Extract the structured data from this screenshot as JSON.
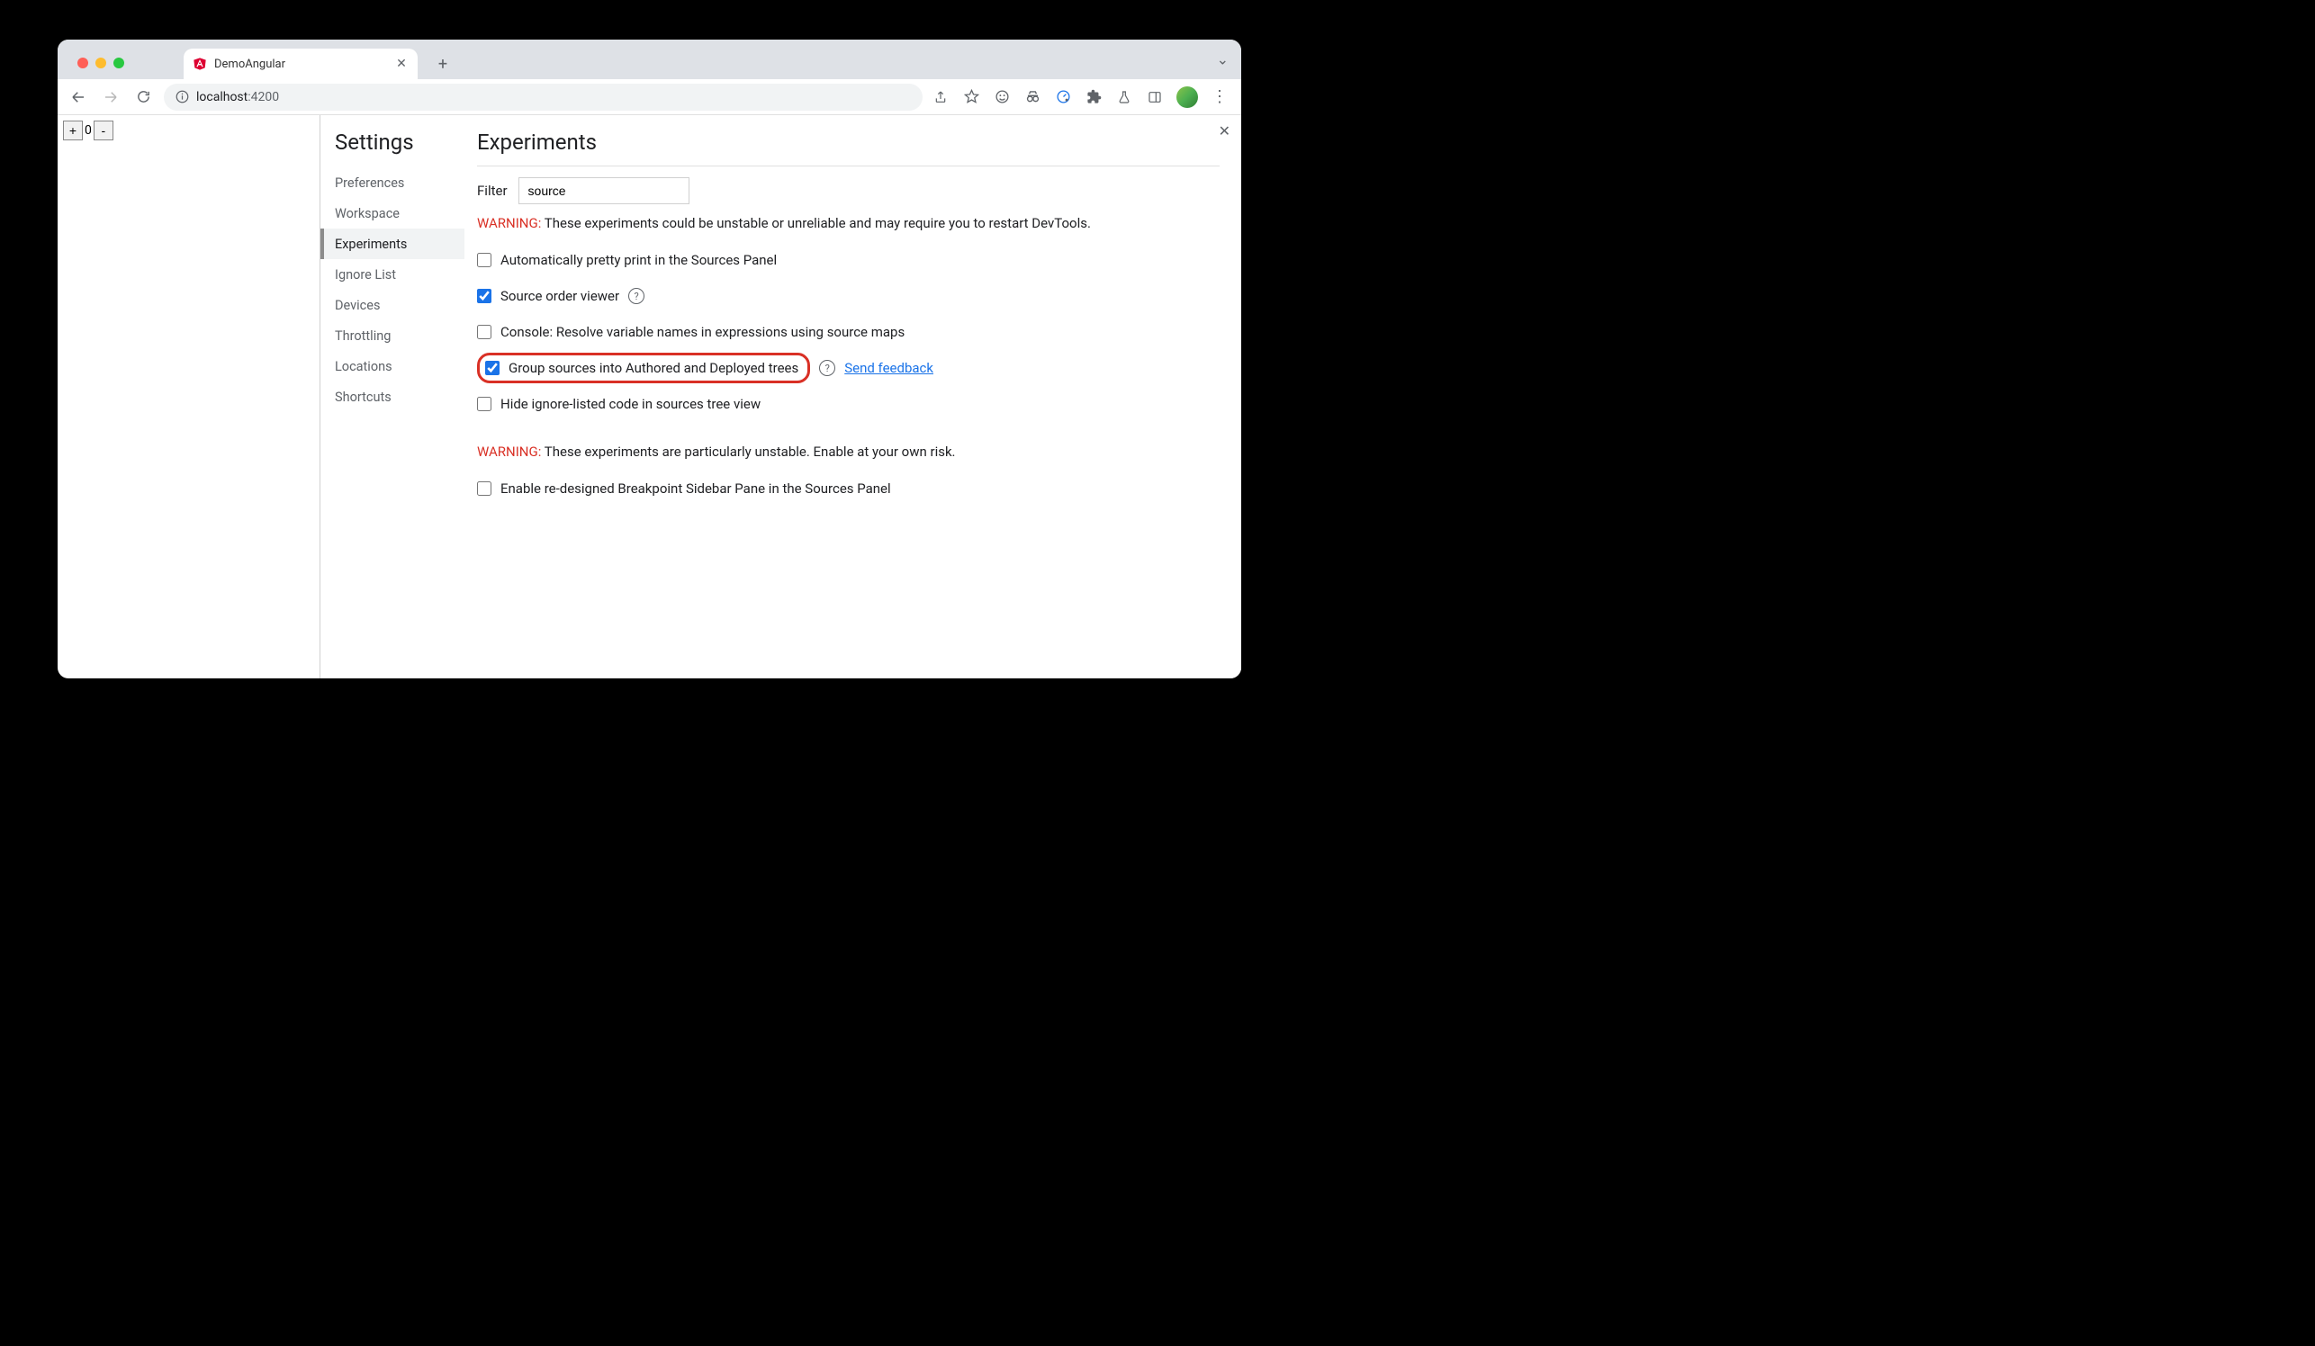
{
  "tab": {
    "title": "DemoAngular"
  },
  "url": {
    "host": "localhost",
    "port": ":4200"
  },
  "counter": {
    "plus": "+",
    "minus": "-",
    "value": "0"
  },
  "sidebar": {
    "title": "Settings",
    "items": [
      "Preferences",
      "Workspace",
      "Experiments",
      "Ignore List",
      "Devices",
      "Throttling",
      "Locations",
      "Shortcuts"
    ],
    "activeIndex": 2
  },
  "main": {
    "title": "Experiments",
    "filterLabel": "Filter",
    "filterValue": "source",
    "warning1Label": "WARNING:",
    "warning1Text": " These experiments could be unstable or unreliable and may require you to restart DevTools.",
    "warning2Label": "WARNING:",
    "warning2Text": " These experiments are particularly unstable. Enable at your own risk.",
    "feedbackLink": "Send feedback",
    "experiments": [
      {
        "label": "Automatically pretty print in the Sources Panel",
        "checked": false,
        "help": false
      },
      {
        "label": "Source order viewer",
        "checked": true,
        "help": true
      },
      {
        "label": "Console: Resolve variable names in expressions using source maps",
        "checked": false,
        "help": false
      },
      {
        "label": "Group sources into Authored and Deployed trees",
        "checked": true,
        "help": true,
        "highlighted": true,
        "feedback": true
      },
      {
        "label": "Hide ignore-listed code in sources tree view",
        "checked": false,
        "help": false
      }
    ],
    "unstableExperiments": [
      {
        "label": "Enable re-designed Breakpoint Sidebar Pane in the Sources Panel",
        "checked": false
      }
    ]
  }
}
